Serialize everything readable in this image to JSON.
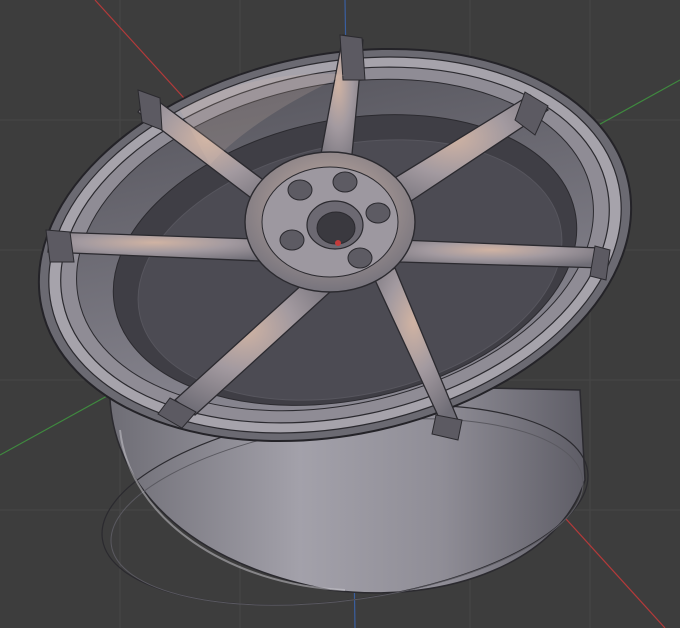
{
  "viewport": {
    "background": "#3d3d3d",
    "grid_color": "#4a4a4a"
  },
  "axes": {
    "x_axis": {
      "name": "x-axis",
      "color": "#b33a3a"
    },
    "y_axis": {
      "name": "y-axis",
      "color": "#3f8a3f"
    },
    "z_axis": {
      "name": "z-axis",
      "color": "#3a5fa0"
    }
  },
  "model": {
    "name": "wheel-rim",
    "spoke_count": 7,
    "lug_count": 5,
    "material_colors": {
      "highlight": "#c9a99a",
      "base": "#8e8c95",
      "shadow": "#54535c",
      "edge": "#2b2a2f"
    }
  }
}
